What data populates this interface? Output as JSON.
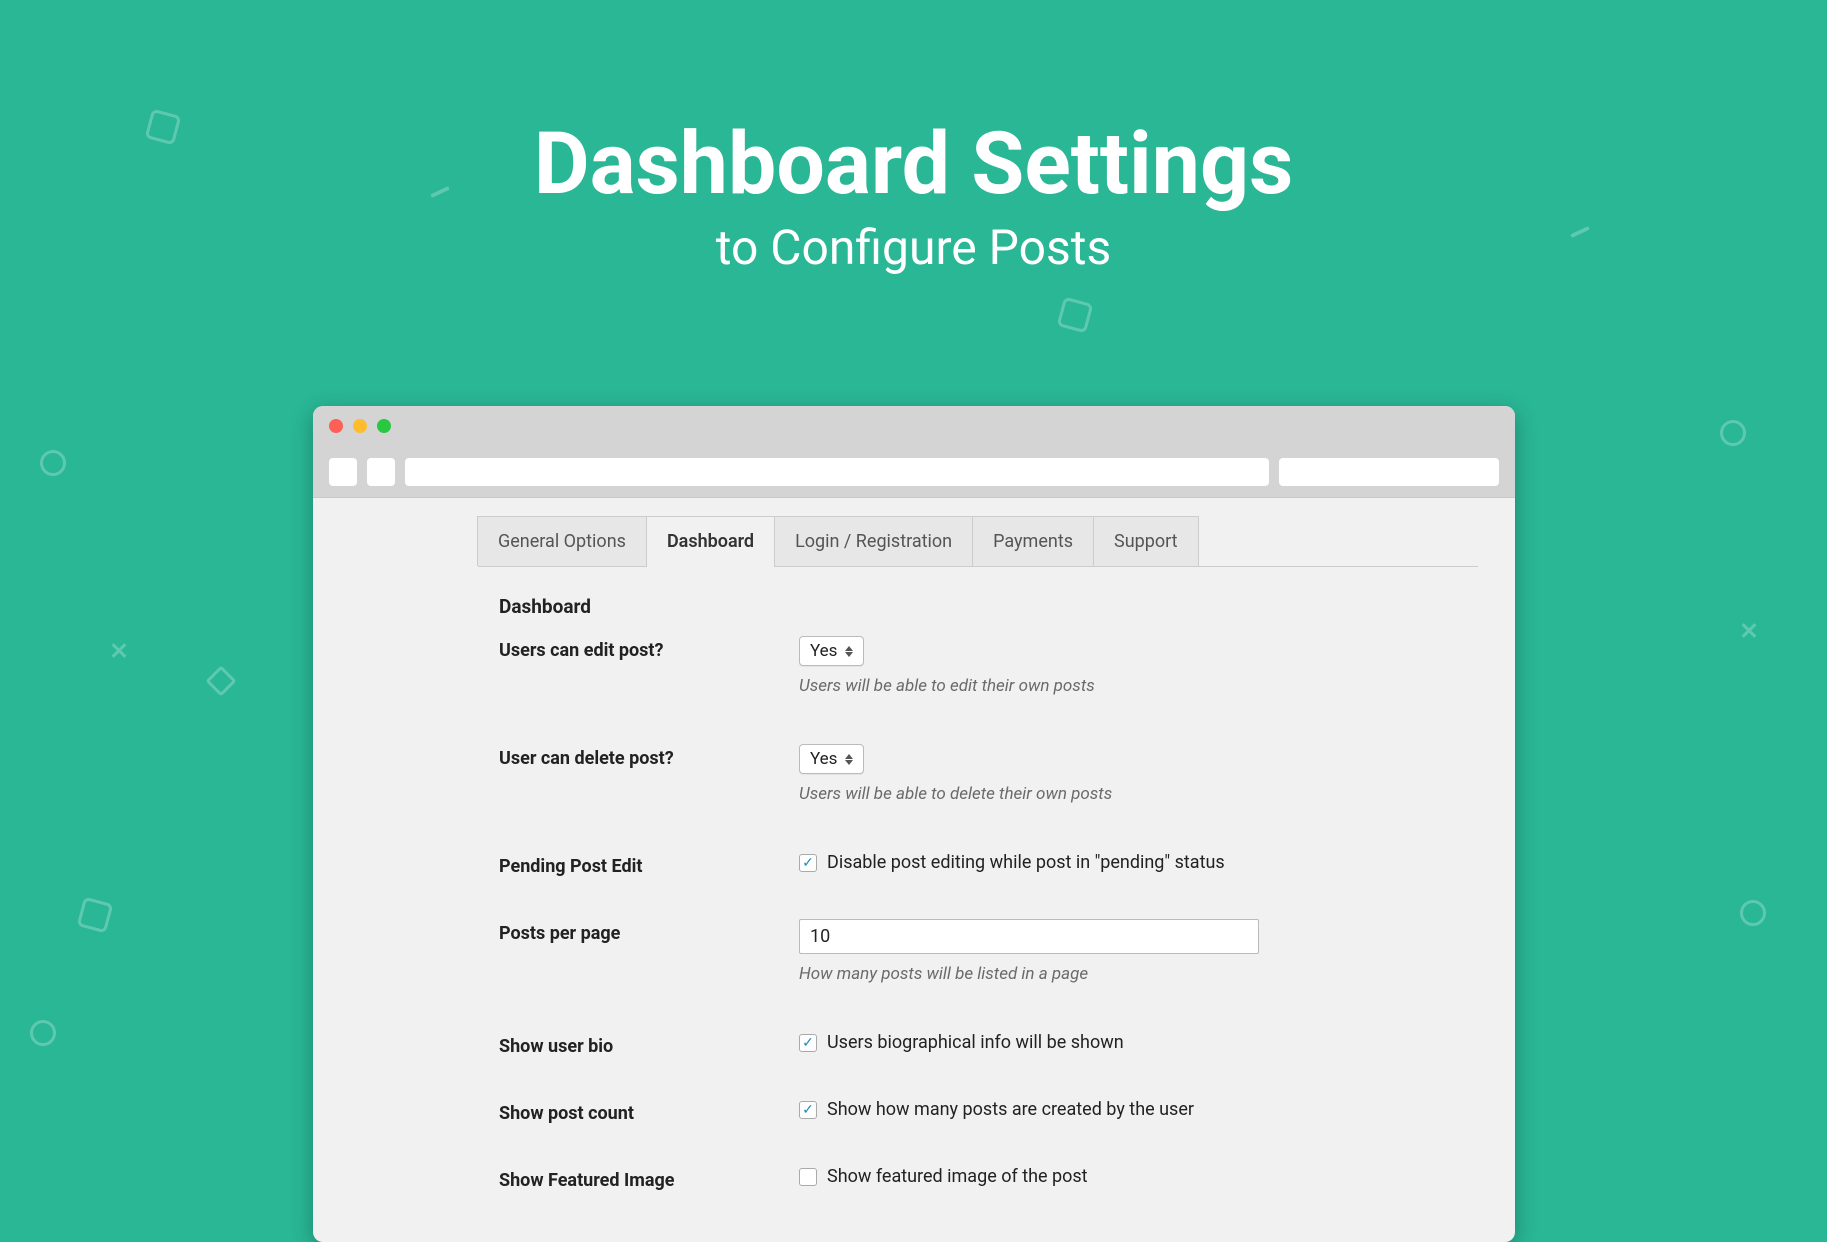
{
  "hero": {
    "title": "Dashboard Settings",
    "subtitle": "to Configure Posts"
  },
  "colors": {
    "accent": "#29b795",
    "dot_red": "#fe5f57",
    "dot_yellow": "#febc2e",
    "dot_green": "#28c840",
    "check": "#1e8cbe"
  },
  "tabs": [
    {
      "label": "General Options",
      "active": false
    },
    {
      "label": "Dashboard",
      "active": true
    },
    {
      "label": "Login / Registration",
      "active": false
    },
    {
      "label": "Payments",
      "active": false
    },
    {
      "label": "Support",
      "active": false
    }
  ],
  "section_title": "Dashboard",
  "rows": {
    "edit": {
      "label": "Users can edit post?",
      "value": "Yes",
      "hint": "Users will be able to edit their own posts"
    },
    "delete": {
      "label": "User can delete post?",
      "value": "Yes",
      "hint": "Users will be able to delete their own posts"
    },
    "pending": {
      "label": "Pending Post Edit",
      "checkbox_label": "Disable post editing while post in \"pending\" status",
      "checked": true
    },
    "per_page": {
      "label": "Posts per page",
      "value": "10",
      "hint": "How many posts will be listed in a page"
    },
    "bio": {
      "label": "Show user bio",
      "checkbox_label": "Users biographical info will be shown",
      "checked": true
    },
    "count": {
      "label": "Show post count",
      "checkbox_label": "Show how many posts are created by the user",
      "checked": true
    },
    "featured": {
      "label": "Show Featured Image",
      "checkbox_label": "Show featured image of the post",
      "checked": false
    }
  }
}
